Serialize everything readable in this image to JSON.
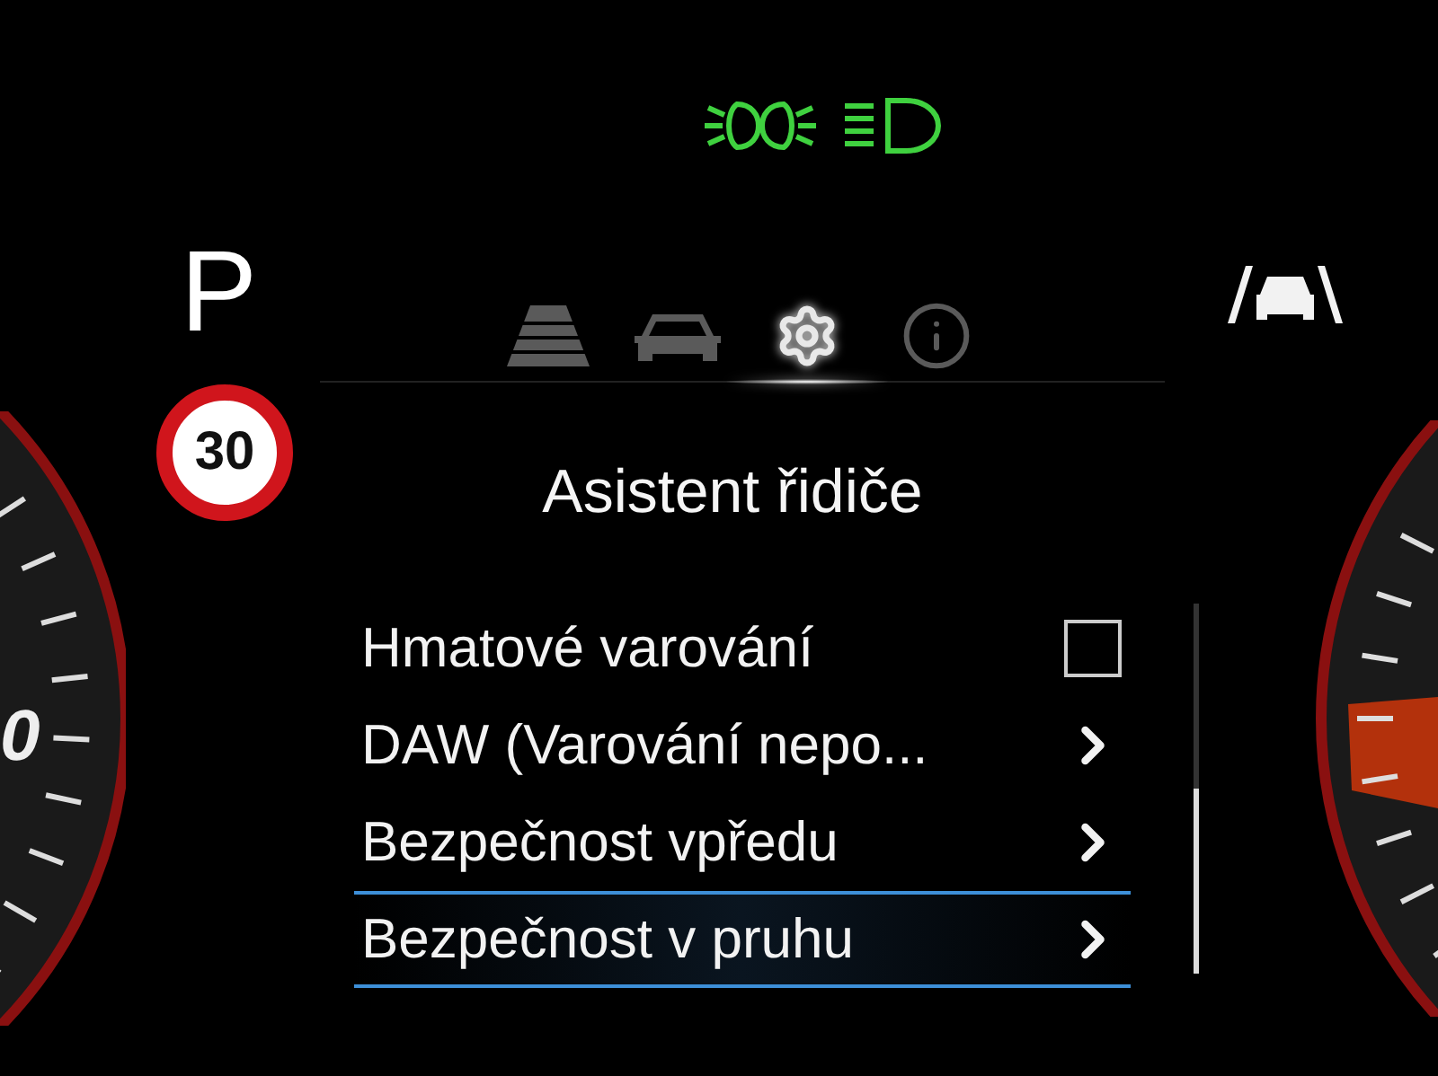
{
  "indicators": [
    {
      "kind": "low-beam",
      "on": true
    },
    {
      "kind": "high-beam",
      "on": true
    }
  ],
  "left_gauge": {
    "label": "0"
  },
  "gear": "P",
  "speed_limit": "30",
  "tabs": [
    {
      "kind": "road",
      "selected": false
    },
    {
      "kind": "car",
      "selected": false
    },
    {
      "kind": "settings",
      "selected": true
    },
    {
      "kind": "info",
      "selected": false
    }
  ],
  "lane_assist": {
    "on": true
  },
  "menu": {
    "title": "Asistent řidiče",
    "items": [
      {
        "kind": "checkbox",
        "label": "Hmatové varování",
        "checked": false,
        "selected": false
      },
      {
        "kind": "submenu",
        "label": "DAW (Varování nepo...",
        "selected": false
      },
      {
        "kind": "submenu",
        "label": "Bezpečnost vpředu",
        "selected": false
      },
      {
        "kind": "submenu",
        "label": "Bezpečnost v pruhu",
        "selected": true
      }
    ]
  }
}
